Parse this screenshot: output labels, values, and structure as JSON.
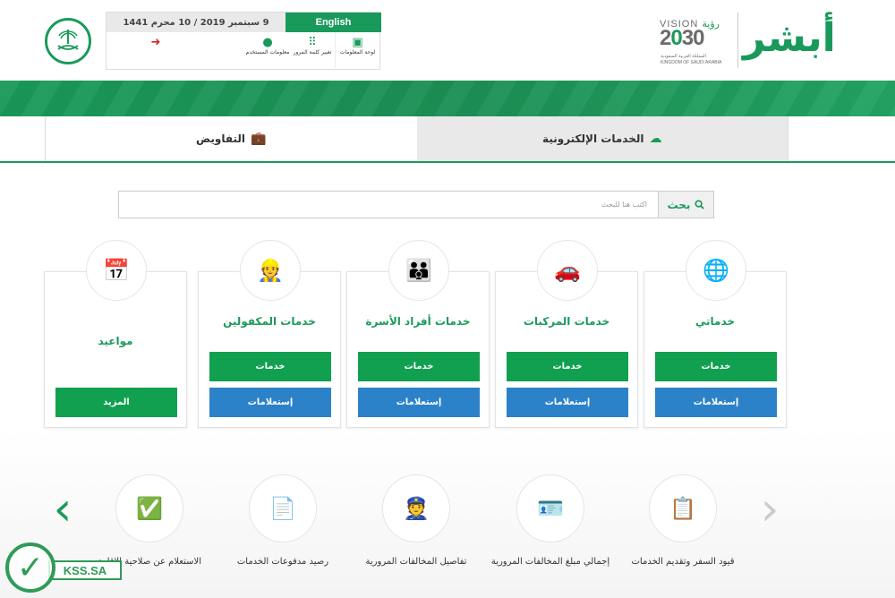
{
  "header": {
    "date": "9 سبتمبر 2019 / 10 محرم 1441",
    "language_button": "English",
    "actions": [
      {
        "label": "لوحة المعلومات",
        "icon": "dashboard-icon"
      },
      {
        "label": "تغيير كلمة المرور",
        "icon": "keypad-icon"
      },
      {
        "label": "معلومات المستخدم",
        "icon": "user-icon"
      },
      {
        "label": "",
        "icon": "logout-icon"
      }
    ],
    "vision": {
      "line1_en": "VISION",
      "line1_ar": "رؤية",
      "year_a": "2",
      "year_b": "0",
      "year_c": "30",
      "line3": "المملكة العربية السعودية",
      "line4": "KINGDOM OF SAUDI ARABIA"
    },
    "logo": "أبشر",
    "emblem": "ministry-emblem-icon"
  },
  "tabs": [
    {
      "label": "الخدمات الإلكترونية",
      "icon": "cloud-icon",
      "active": true
    },
    {
      "label": "التفاويض",
      "icon": "briefcase-icon",
      "active": false
    }
  ],
  "search": {
    "button_label": "بحث",
    "placeholder": "اكتب هنا للبحث"
  },
  "cards": [
    {
      "title": "خدماتي",
      "icon": "globe-icon",
      "buttons": [
        "خدمات",
        "إستعلامات"
      ]
    },
    {
      "title": "خدمات المركبات",
      "icon": "vehicle-icon",
      "buttons": [
        "خدمات",
        "إستعلامات"
      ]
    },
    {
      "title": "خدمات أفراد الأسرة",
      "icon": "family-icon",
      "buttons": [
        "خدمات",
        "إستعلامات"
      ]
    },
    {
      "title": "خدمات المكفولين",
      "icon": "workers-icon",
      "buttons": [
        "خدمات",
        "إستعلامات"
      ]
    },
    {
      "title": "مواعيد",
      "icon": "calendar-icon",
      "buttons": [
        "المزيد"
      ]
    }
  ],
  "quick_services": [
    {
      "label": "قيود السفر وتقديم الخدمات",
      "icon": "travel-restriction-icon"
    },
    {
      "label": "إجمالي مبلغ المخالفات المرورية",
      "icon": "id-card-icon"
    },
    {
      "label": "تفاصيل المخالفات المرورية",
      "icon": "traffic-officer-icon"
    },
    {
      "label": "رصيد مدفوعات الخدمات",
      "icon": "document-search-icon"
    },
    {
      "label": "الاستعلام عن صلاحية الإقامة",
      "icon": "id-check-icon"
    }
  ],
  "carousel": {
    "prev": "‹",
    "next": "›"
  },
  "watermark": {
    "text": "KSS.SA"
  },
  "colors": {
    "primary": "#1a9a5a",
    "blue": "#2c82c9",
    "tab_active": "#e9e9e9"
  }
}
